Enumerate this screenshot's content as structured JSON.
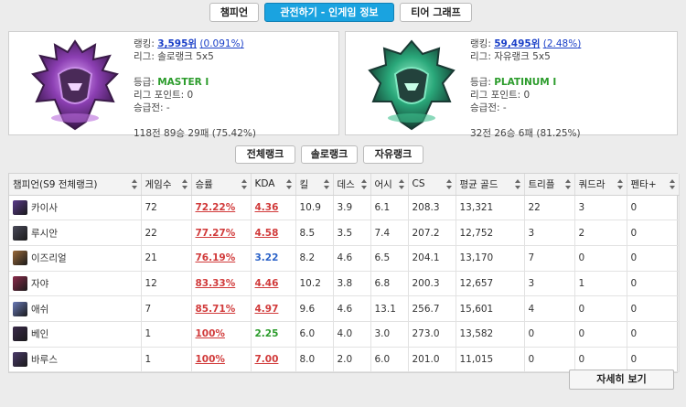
{
  "tabs": [
    {
      "label": "챔피언",
      "active": false
    },
    {
      "label": "관전하기 - 인게임 정보",
      "active": true
    },
    {
      "label": "티어 그래프",
      "active": false
    }
  ],
  "solo": {
    "ranking_label": "랭킹:",
    "ranking_value": "3,595위",
    "ranking_pct": "0.091%",
    "league_label": "리그: 솔로랭크 5x5",
    "tier_label": "등급:",
    "tier_value": "MASTER I",
    "lp_label": "리그 포인트: 0",
    "promo_label": "승급전: -",
    "record": "118전 89승 29패 (75.42%)",
    "emblem_icon": "master-emblem-icon",
    "emblem_color": "#8c3fb3"
  },
  "flex": {
    "ranking_label": "랭킹:",
    "ranking_value": "59,495위",
    "ranking_pct": "2.48%",
    "league_label": "리그: 자유랭크 5x5",
    "tier_label": "등급:",
    "tier_value": "PLATINUM I",
    "lp_label": "리그 포인트: 0",
    "promo_label": "승급전: -",
    "record": "32전 26승 6패 (81.25%)",
    "emblem_icon": "platinum-emblem-icon",
    "emblem_color": "#2aa87a"
  },
  "queue_buttons": [
    "전체랭크",
    "솔로랭크",
    "자유랭크"
  ],
  "table": {
    "headers": [
      "챔피언(S9 전체랭크)",
      "게임수",
      "승률",
      "KDA",
      "킬",
      "데스",
      "어시",
      "CS",
      "평균 골드",
      "트리플",
      "쿼드라",
      "펜타+"
    ],
    "rows": [
      {
        "champ": "카이사",
        "games": "72",
        "winrate": "72.22%",
        "kda": "4.36",
        "kda_class": "kda-red",
        "kills": "10.9",
        "deaths": "3.9",
        "assists": "6.1",
        "cs": "208.3",
        "gold": "13,321",
        "triple": "22",
        "quadra": "3",
        "penta": "0",
        "icon_color": "#5a3a8c"
      },
      {
        "champ": "루시안",
        "games": "22",
        "winrate": "77.27%",
        "kda": "4.58",
        "kda_class": "kda-red",
        "kills": "8.5",
        "deaths": "3.5",
        "assists": "7.4",
        "cs": "207.2",
        "gold": "12,752",
        "triple": "3",
        "quadra": "2",
        "penta": "0",
        "icon_color": "#4a4a5a"
      },
      {
        "champ": "이즈리얼",
        "games": "21",
        "winrate": "76.19%",
        "kda": "3.22",
        "kda_class": "kda-blue",
        "kills": "8.2",
        "deaths": "4.6",
        "assists": "6.5",
        "cs": "204.1",
        "gold": "13,170",
        "triple": "7",
        "quadra": "0",
        "penta": "0",
        "icon_color": "#9a6a3a"
      },
      {
        "champ": "자야",
        "games": "12",
        "winrate": "83.33%",
        "kda": "4.46",
        "kda_class": "kda-red",
        "kills": "10.2",
        "deaths": "3.8",
        "assists": "6.8",
        "cs": "200.3",
        "gold": "12,657",
        "triple": "3",
        "quadra": "1",
        "penta": "0",
        "icon_color": "#8a2a4a"
      },
      {
        "champ": "애쉬",
        "games": "7",
        "winrate": "85.71%",
        "kda": "4.97",
        "kda_class": "kda-red",
        "kills": "9.6",
        "deaths": "4.6",
        "assists": "13.1",
        "cs": "256.7",
        "gold": "15,601",
        "triple": "4",
        "quadra": "0",
        "penta": "0",
        "icon_color": "#6a7ab8"
      },
      {
        "champ": "베인",
        "games": "1",
        "winrate": "100%",
        "kda": "2.25",
        "kda_class": "kda-green",
        "kills": "6.0",
        "deaths": "4.0",
        "assists": "3.0",
        "cs": "273.0",
        "gold": "13,582",
        "triple": "0",
        "quadra": "0",
        "penta": "0",
        "icon_color": "#3a2a4a"
      },
      {
        "champ": "바루스",
        "games": "1",
        "winrate": "100%",
        "kda": "7.00",
        "kda_class": "kda-red",
        "kills": "8.0",
        "deaths": "2.0",
        "assists": "6.0",
        "cs": "201.0",
        "gold": "11,015",
        "triple": "0",
        "quadra": "0",
        "penta": "0",
        "icon_color": "#4a3a6a"
      }
    ]
  },
  "more_button": "자세히 보기"
}
